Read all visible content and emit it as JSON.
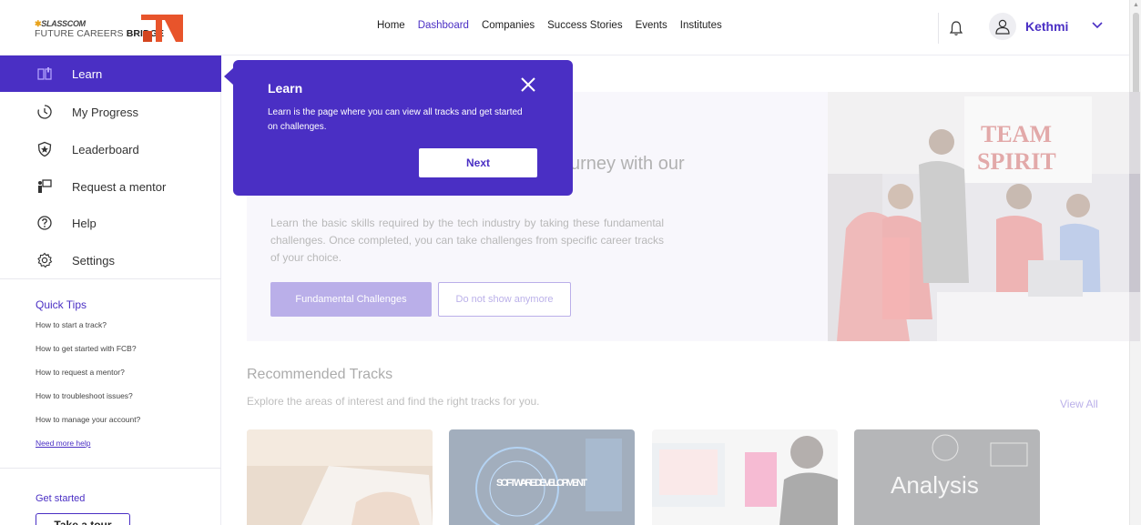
{
  "header": {
    "logo_top": "SLASSCOM",
    "logo_bottom_light": "FUTURE CAREERS ",
    "logo_bottom_bold": "BRIDGE",
    "nav": [
      "Home",
      "Dashboard",
      "Companies",
      "Success Stories",
      "Events",
      "Institutes"
    ],
    "active_nav": "Dashboard",
    "username": "Kethmi"
  },
  "sidebar": {
    "items": [
      {
        "label": "Learn",
        "icon": "book-icon",
        "active": true
      },
      {
        "label": "My Progress",
        "icon": "progress-clock-icon"
      },
      {
        "label": "Leaderboard",
        "icon": "star-shield-icon"
      },
      {
        "label": "Request a mentor",
        "icon": "mentor-board-icon"
      },
      {
        "label": "Help",
        "icon": "help-circle-icon"
      },
      {
        "label": "Settings",
        "icon": "gear-icon"
      }
    ],
    "quick_tips_title": "Quick Tips",
    "quick_tips": [
      "How to start a track?",
      "How to get started with FCB?",
      "How to request a mentor?",
      "How to troubleshoot issues?",
      "How to manage your account?"
    ],
    "need_more_help": "Need more help",
    "get_started_title": "Get started",
    "take_tour": "Take a tour"
  },
  "hero": {
    "title_visible": "urney with our",
    "description": "Learn the basic skills required by the tech industry by taking these fundamental challenges. Once completed, you can take challenges from specific career tracks of your choice.",
    "primary_button": "Fundamental Challenges",
    "secondary_button": "Do not show anymore",
    "image_banner_line1": "TEAM",
    "image_banner_line2": "SPIRIT"
  },
  "recommended": {
    "title": "Recommended Tracks",
    "subtitle": "Explore the areas of interest and find the right tracks for you.",
    "view_all": "View All",
    "cards": [
      {
        "label": ""
      },
      {
        "label": "SOFTWARE DEVELOPMENT"
      },
      {
        "label": ""
      },
      {
        "label": "Analysis"
      }
    ]
  },
  "popover": {
    "title": "Learn",
    "text": "Learn is the page where you can view all tracks and get started on challenges.",
    "next_button": "Next"
  },
  "colors": {
    "brand": "#4a2fc4",
    "logo_orange": "#e8542b"
  }
}
